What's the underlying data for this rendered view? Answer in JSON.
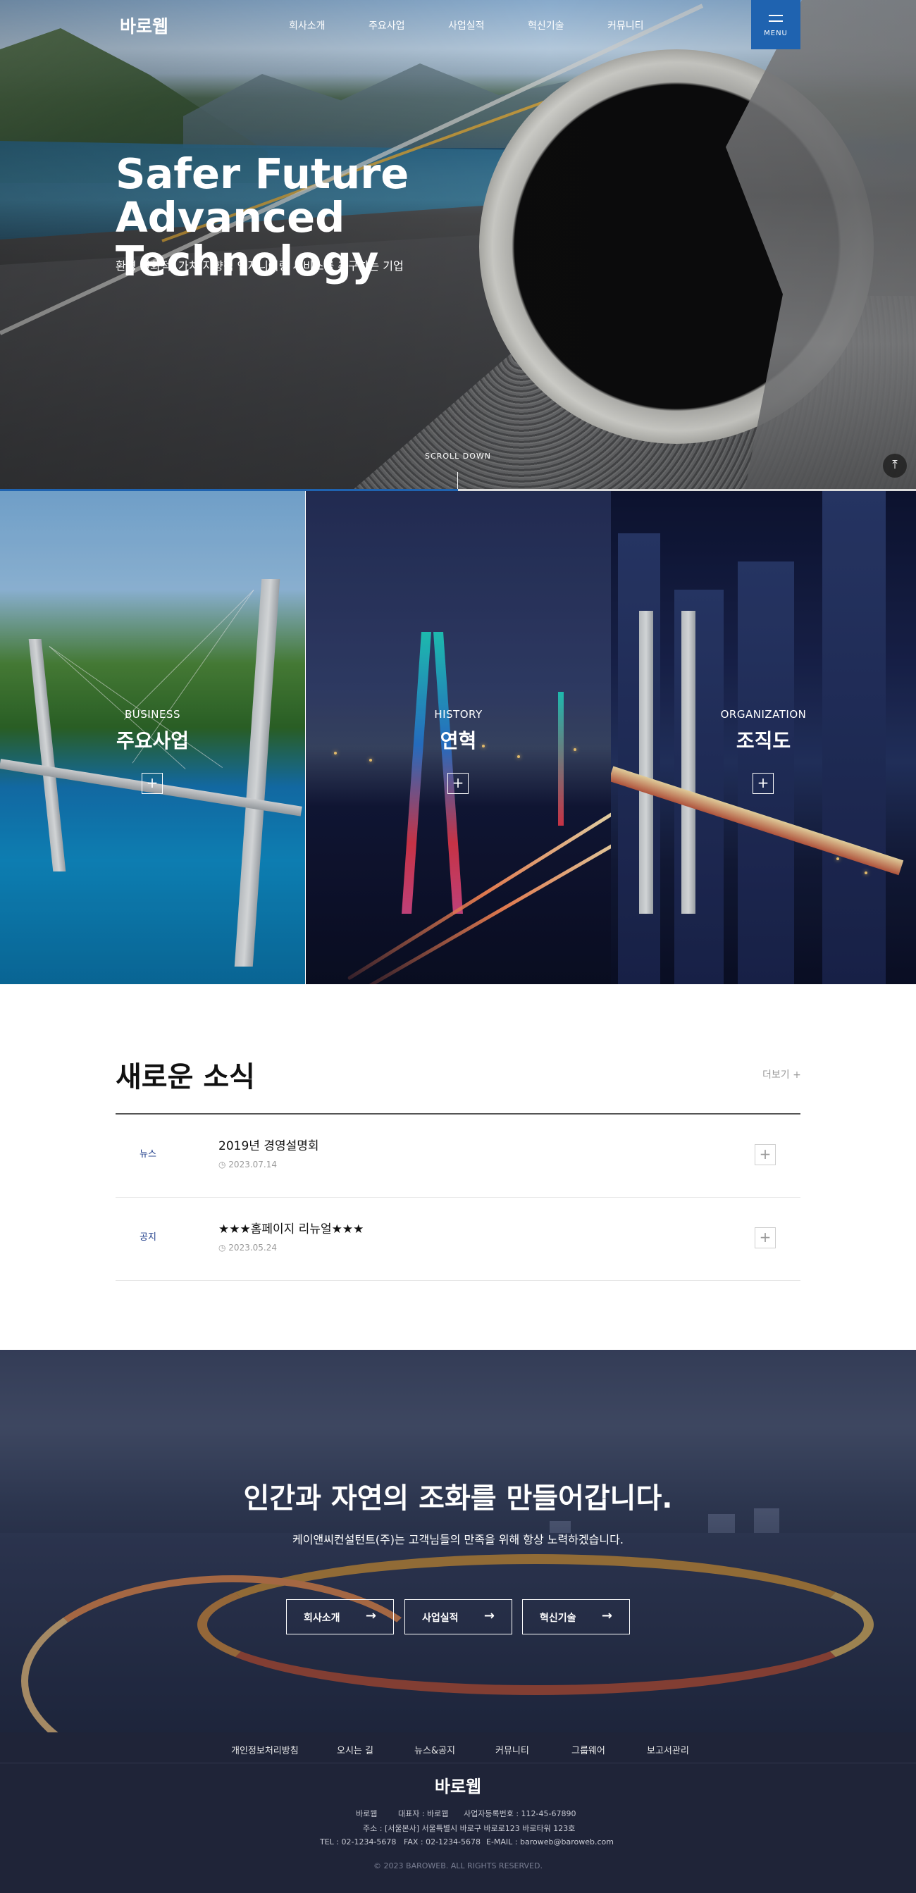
{
  "header": {
    "logo": "바로웹",
    "nav": [
      "회사소개",
      "주요사업",
      "사업실적",
      "혁신기술",
      "커뮤니티"
    ],
    "menu_label": "MENU"
  },
  "hero": {
    "title_line1": "Safer Future",
    "title_line2": "Advanced Technology",
    "subtitle": "환경 친화적, 가치 지향적 엔지니어링 서비스를 추구하는 기업",
    "scroll_label": "SCROLL DOWN",
    "top_icon": "arrow-up-to-top-icon"
  },
  "panels": [
    {
      "en": "BUSINESS",
      "ko": "주요사업"
    },
    {
      "en": "HISTORY",
      "ko": "연혁"
    },
    {
      "en": "ORGANIZATION",
      "ko": "조직도"
    }
  ],
  "news": {
    "title": "새로운 소식",
    "more": "더보기 +",
    "items": [
      {
        "category": "뉴스",
        "title": "2019년 경영설명회",
        "date": "2023.07.14"
      },
      {
        "category": "공지",
        "title": "★★★홈페이지 리뉴얼★★★",
        "date": "2023.05.24"
      }
    ]
  },
  "banner": {
    "title": "인간과 자연의 조화를 만들어갑니다.",
    "subtitle": "케이앤씨컨설턴트(주)는 고객님들의 만족을 위해 항상 노력하겠습니다.",
    "buttons": [
      "회사소개",
      "사업실적",
      "혁신기술"
    ]
  },
  "footer": {
    "links": [
      "개인정보처리방침",
      "오시는 길",
      "뉴스&공지",
      "커뮤니티",
      "그룹웨어",
      "보고서관리"
    ],
    "logo": "바로웹",
    "company": "바로웹",
    "ceo": "대표자 : 바로웹",
    "biz_no": "사업자등록번호 : 112-45-67890",
    "address": "주소 : [서울본사] 서울특별시 바로구 바로로123 바로타워 123호",
    "tel": "TEL : 02-1234-5678",
    "fax": "FAX : 02-1234-5678",
    "email": "E-MAIL : baroweb@baroweb.com",
    "copyright": "© 2023 BAROWEB. ALL RIGHTS RESERVED."
  },
  "colors": {
    "accent": "#1f63b0",
    "news_category": "#1f3d8a",
    "footer_bg": "#1f2438"
  }
}
